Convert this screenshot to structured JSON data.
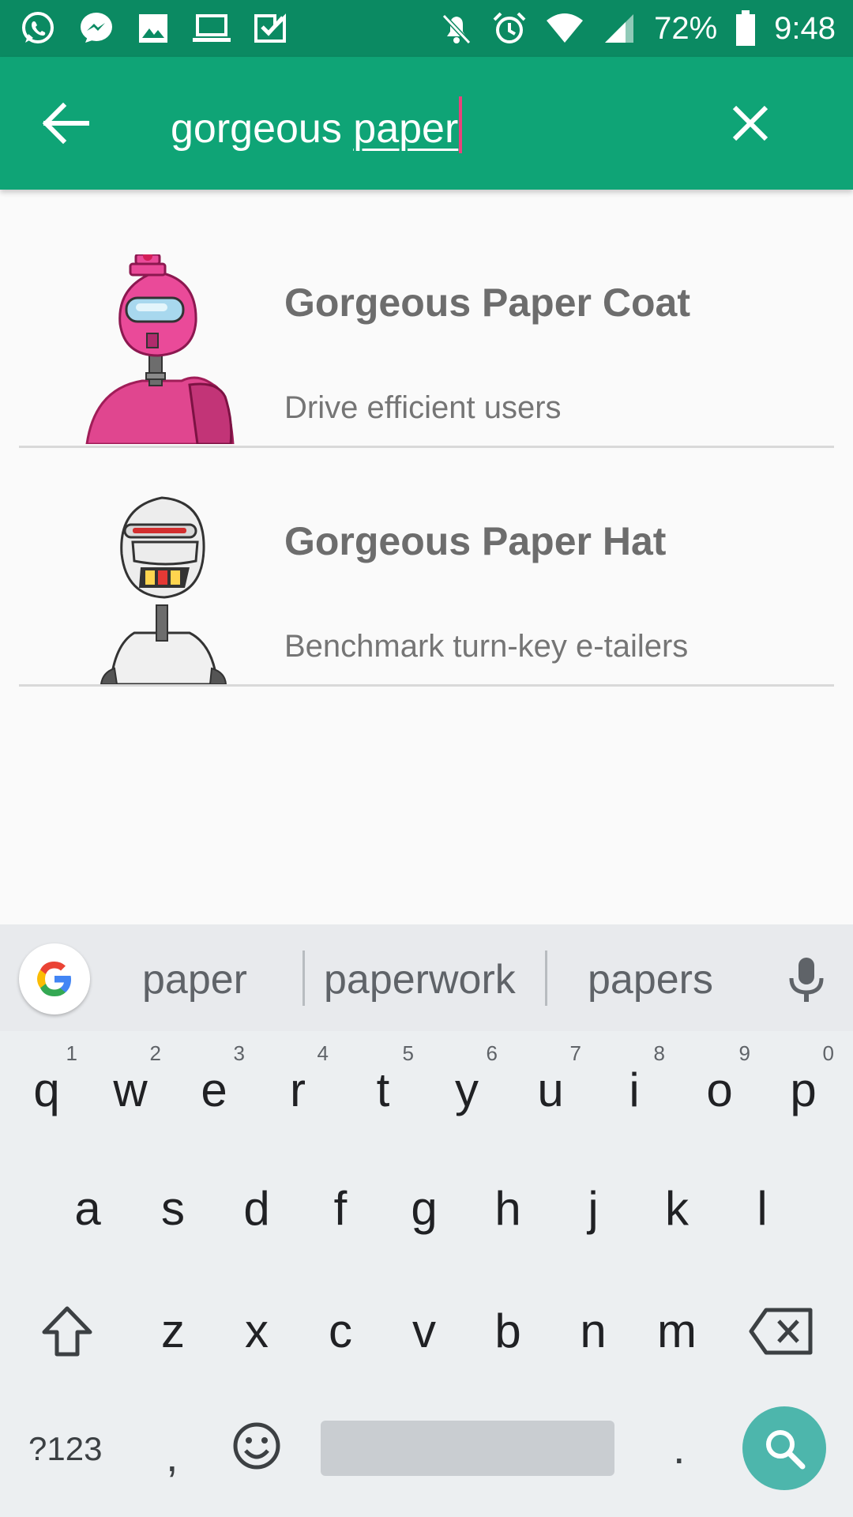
{
  "status_bar": {
    "battery": "72%",
    "time": "9:48",
    "icons": [
      "whatsapp-icon",
      "messenger-icon",
      "image-icon",
      "laptop-icon",
      "tasks-icon",
      "bell-off-icon",
      "alarm-icon",
      "wifi-icon",
      "signal-icon",
      "battery-icon"
    ]
  },
  "app_bar": {
    "query_plain": "gorgeous ",
    "query_underlined": "paper",
    "back_icon": "arrow-back-icon",
    "clear_icon": "close-icon",
    "color": "#0fa476"
  },
  "results": [
    {
      "title": "Gorgeous Paper Coat",
      "subtitle": "Drive efficient users",
      "image": "pink-robot"
    },
    {
      "title": "Gorgeous Paper Hat",
      "subtitle": "Benchmark turn-key e-tailers",
      "image": "white-robot"
    }
  ],
  "keyboard": {
    "suggestions": [
      "paper",
      "paperwork",
      "papers"
    ],
    "row1": [
      {
        "k": "q",
        "h": "1"
      },
      {
        "k": "w",
        "h": "2"
      },
      {
        "k": "e",
        "h": "3"
      },
      {
        "k": "r",
        "h": "4"
      },
      {
        "k": "t",
        "h": "5"
      },
      {
        "k": "y",
        "h": "6"
      },
      {
        "k": "u",
        "h": "7"
      },
      {
        "k": "i",
        "h": "8"
      },
      {
        "k": "o",
        "h": "9"
      },
      {
        "k": "p",
        "h": "0"
      }
    ],
    "row2": [
      "a",
      "s",
      "d",
      "f",
      "g",
      "h",
      "j",
      "k",
      "l"
    ],
    "row3": [
      "z",
      "x",
      "c",
      "v",
      "b",
      "n",
      "m"
    ],
    "symbols_label": "?123",
    "comma": ",",
    "period": ".",
    "search_key_color": "#4db6ac"
  }
}
